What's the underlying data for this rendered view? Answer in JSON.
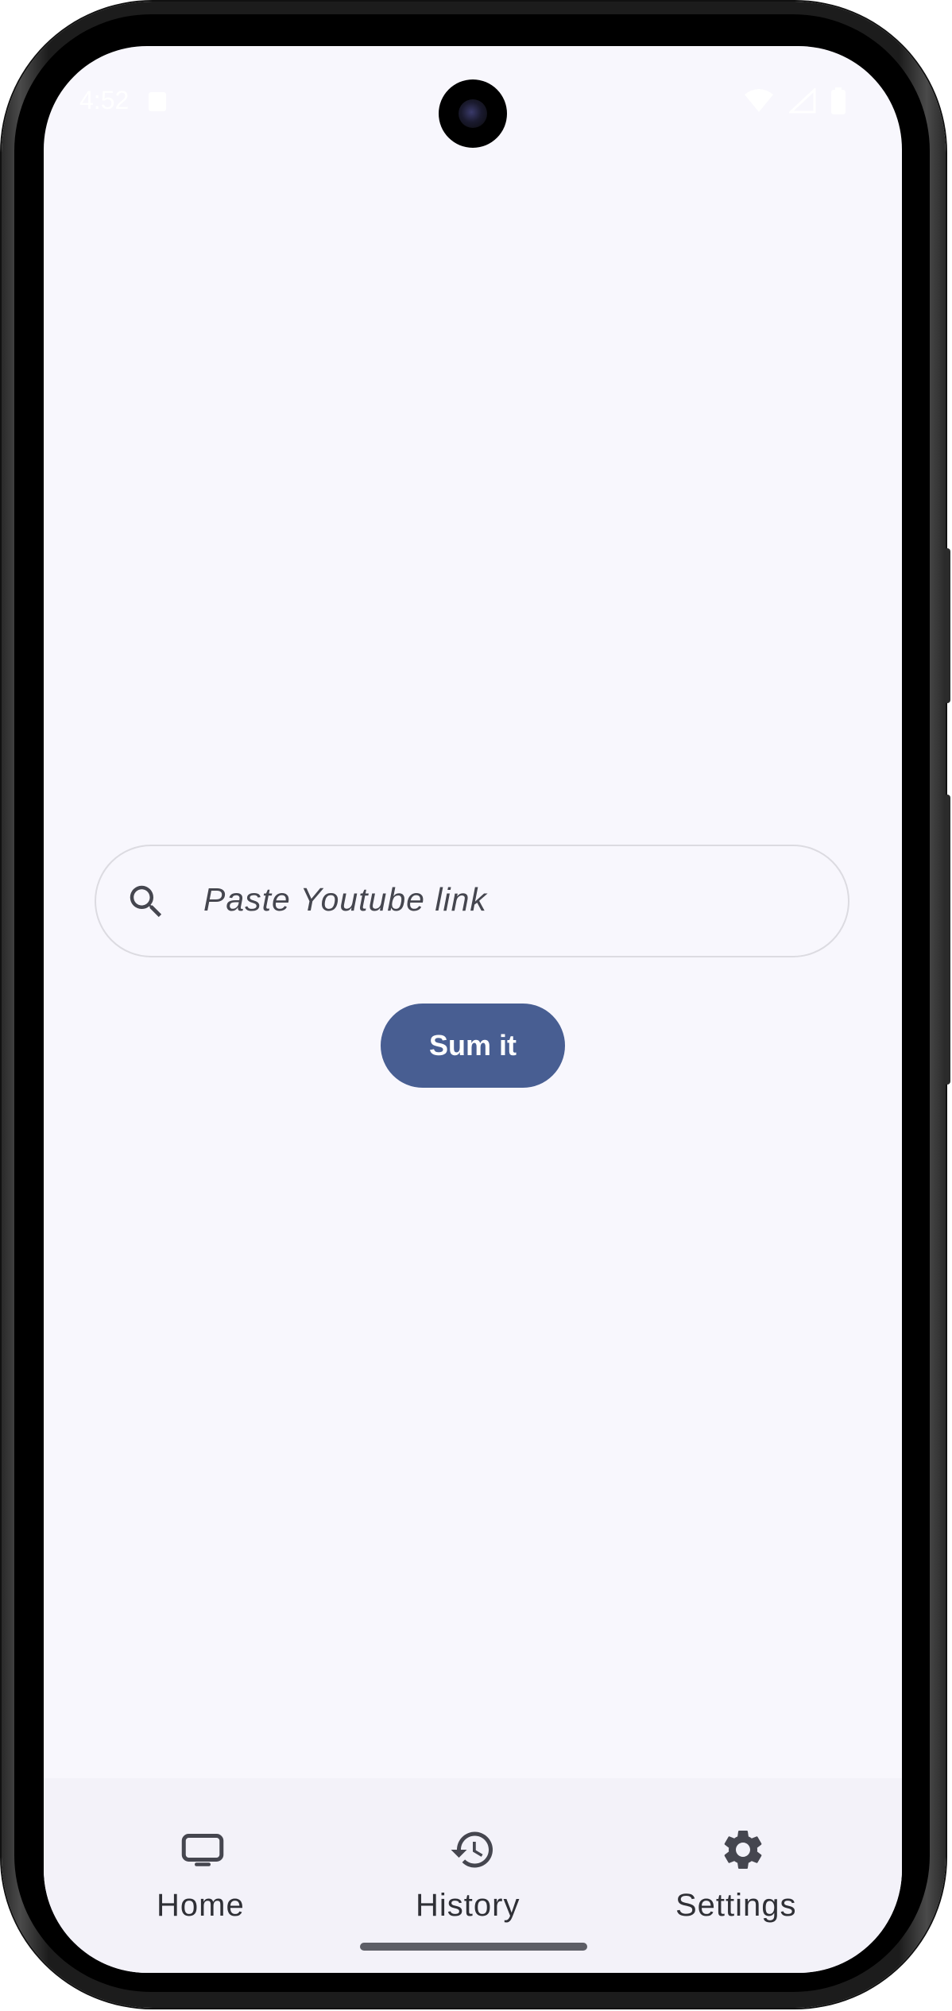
{
  "status_bar": {
    "time": "4:52",
    "icons": [
      "wifi-icon",
      "signal-icon",
      "battery-icon"
    ]
  },
  "search": {
    "placeholder": "Paste Youtube link",
    "icon": "search-icon"
  },
  "actions": {
    "submit_label": "Sum it"
  },
  "bottom_nav": {
    "items": [
      {
        "label": "Home",
        "icon": "tv-icon"
      },
      {
        "label": "History",
        "icon": "history-icon"
      },
      {
        "label": "Settings",
        "icon": "gear-icon"
      }
    ]
  },
  "colors": {
    "background": "#f8f7fd",
    "primary": "#485e92",
    "nav_background": "#f3f2f9",
    "text": "#2f3036"
  }
}
